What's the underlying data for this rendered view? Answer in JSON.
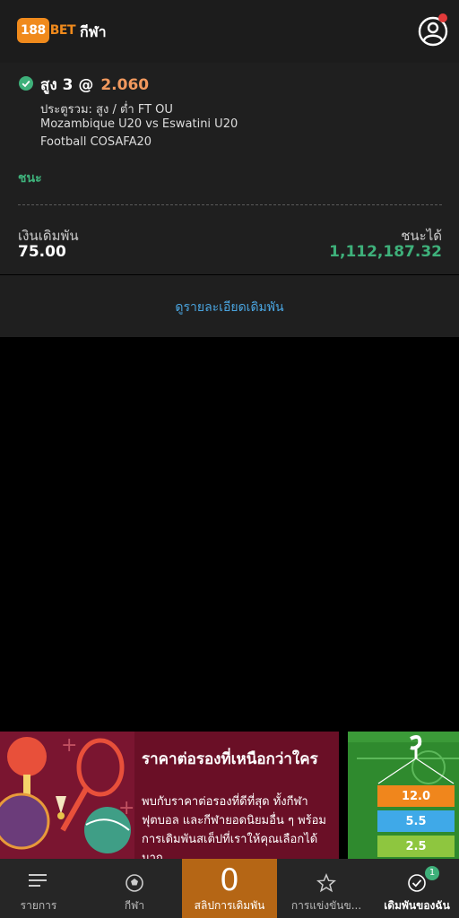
{
  "header": {
    "logo_num": "188",
    "logo_text": "BET",
    "title": "กีฬา"
  },
  "bet": {
    "selection": "สูง 3 @",
    "odds": "2.060",
    "market": "ประตูรวม: สูง / ต่ำ  FT OU",
    "match": "Mozambique U20 vs Eswatini U20",
    "league": "Football COSAFA20",
    "status": "ชนะ",
    "stake_label": "เงินเดิมพัน",
    "stake_value": "75.00",
    "win_label": "ชนะได้",
    "win_value": "1,112,187.32",
    "details_link": "ดูรายละเอียดเดิมพัน"
  },
  "promo": {
    "title": "ราคาต่อรองที่เหนือกว่าใคร",
    "body": "พบกับราคาต่อรองที่ดีที่สุด ทั้งกีฬาฟุตบอล และกีฬายอดนิยมอื่น ๆ พร้อมการเดิมพันสเต็ปที่เราให้คุณเลือกได้มาก",
    "odds": [
      "12.0",
      "5.5",
      "2.5"
    ]
  },
  "tabs": {
    "menu": "รายการ",
    "sports": "กีฬา",
    "betslip_count": "0",
    "betslip": "สลิปการเดิมพัน",
    "favorites": "การแข่งขันข...",
    "mybets": "เดิมพันของฉัน",
    "mybets_badge": "1"
  },
  "colors": {
    "brand": "#f08a1c",
    "win_green": "#3eb07a",
    "odds_orange": "#f2995e",
    "link_blue": "#4aa5e0",
    "betslip_tab": "#b56615"
  }
}
